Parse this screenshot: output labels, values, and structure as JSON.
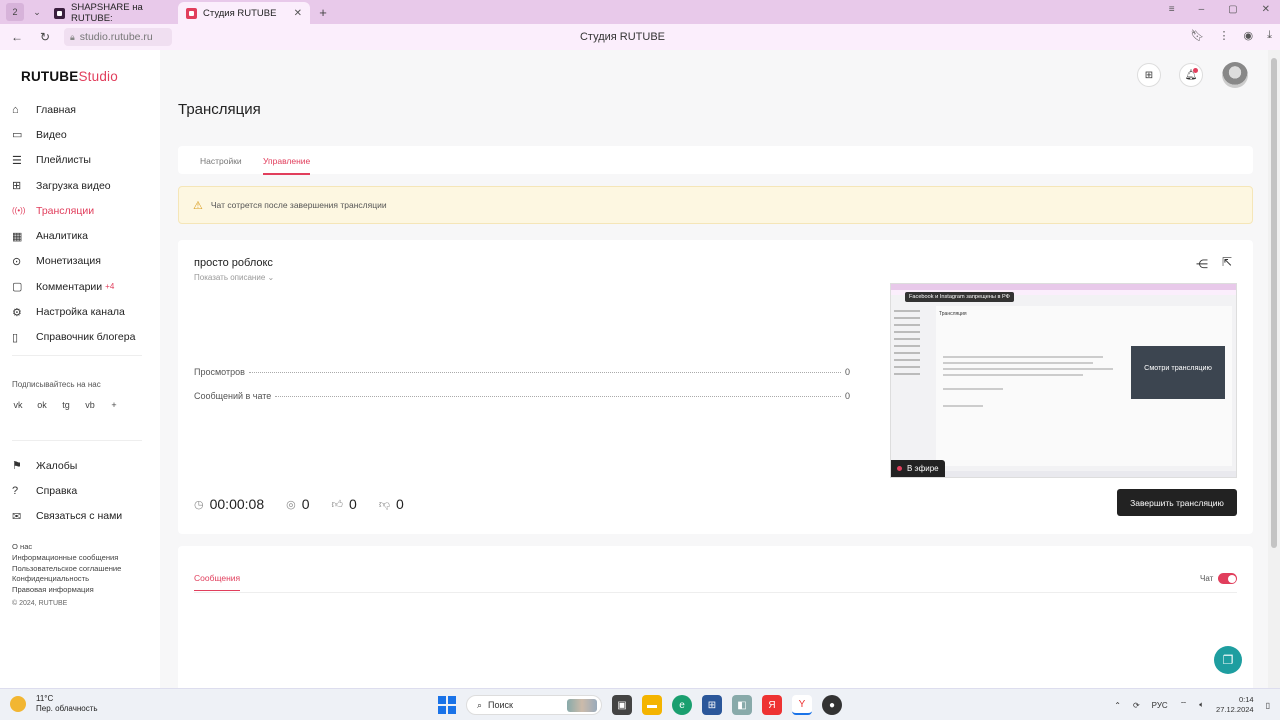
{
  "browser": {
    "tab_counter": "2",
    "tabs": [
      {
        "title": "SHAPSHARE на RUTUBE:",
        "active": false
      },
      {
        "title": "Студия RUTUBE",
        "active": true
      }
    ],
    "url": "studio.rutube.ru",
    "page_title": "Студия RUTUBE"
  },
  "logo": {
    "brand": "RUTUBE",
    "suffix": "Studio"
  },
  "sidebar": {
    "items": [
      {
        "label": "Главная",
        "icon": "home-icon",
        "glyph": "⌂"
      },
      {
        "label": "Видео",
        "icon": "video-icon",
        "glyph": "▭"
      },
      {
        "label": "Плейлисты",
        "icon": "playlist-icon",
        "glyph": "☰"
      },
      {
        "label": "Загрузка видео",
        "icon": "upload-icon",
        "glyph": "⊞"
      },
      {
        "label": "Трансляции",
        "icon": "broadcast-icon",
        "glyph": "((•))",
        "active": true
      },
      {
        "label": "Аналитика",
        "icon": "analytics-icon",
        "glyph": "▦"
      },
      {
        "label": "Монетизация",
        "icon": "monetization-icon",
        "glyph": "⊙"
      },
      {
        "label": "Комментарии",
        "icon": "comments-icon",
        "glyph": "▢",
        "badge": "+4"
      },
      {
        "label": "Настройка канала",
        "icon": "settings-icon",
        "glyph": "⚙"
      },
      {
        "label": "Справочник блогера",
        "icon": "book-icon",
        "glyph": "▯"
      }
    ],
    "subscribe_label": "Подписывайтесь на нас",
    "socials": [
      "vk",
      "ok",
      "tg",
      "vb",
      "+"
    ],
    "secondary": [
      {
        "label": "Жалобы",
        "icon": "flag-icon",
        "glyph": "⚑"
      },
      {
        "label": "Справка",
        "icon": "help-icon",
        "glyph": "?"
      },
      {
        "label": "Связаться с нами",
        "icon": "mail-icon",
        "glyph": "✉"
      }
    ],
    "footer_links": [
      "О нас",
      "Информационные сообщения",
      "Пользовательское соглашение",
      "Конфиденциальность",
      "Правовая информация"
    ],
    "copyright": "© 2024, RUTUBE"
  },
  "page": {
    "title": "Трансляция",
    "tabs": [
      {
        "label": "Настройки",
        "active": false
      },
      {
        "label": "Управление",
        "active": true
      }
    ],
    "warning": "Чат сотрется после завершения трансляции"
  },
  "stream": {
    "title": "просто роблокс",
    "show_description": "Показать описание",
    "stats": [
      {
        "label": "Просмотров",
        "value": "0"
      },
      {
        "label": "Сообщений в чате",
        "value": "0"
      }
    ],
    "duration": "00:00:08",
    "viewers": "0",
    "likes": "0",
    "dislikes": "0",
    "end_button": "Завершить трансляцию",
    "preview": {
      "banner": "Facebook и Instagram запрещены в РФ",
      "page_heading": "Трансляция",
      "overlay": "Смотри трансляцию",
      "on_air": "В эфире"
    }
  },
  "chat": {
    "tab": "Сообщения",
    "toggle_label": "Чат",
    "enabled": true
  },
  "taskbar": {
    "temperature": "11°C",
    "weather": "Пер. облачность",
    "search": "Поиск",
    "lang": "РУС",
    "time": "0:14",
    "date": "27.12.2024"
  },
  "colors": {
    "accent": "#e13e5c",
    "dark_button": "#222222",
    "fab": "#1e9ea0"
  }
}
